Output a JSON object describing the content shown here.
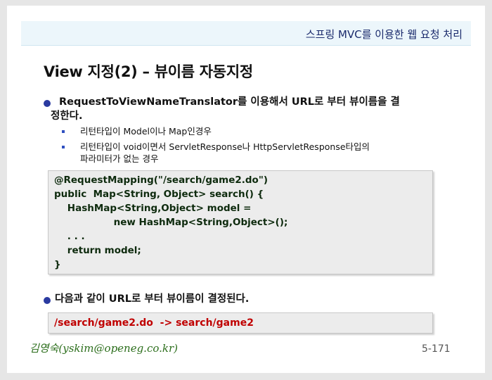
{
  "header": {
    "title": "스프링 MVC를 이용한 웹 요청 처리"
  },
  "slide": {
    "title": "View 지정(2) – 뷰이름 자동지정"
  },
  "bullets": {
    "first_line1": "RequestToViewNameTranslator를 이용해서 URL로 부터 뷰이름을 결",
    "first_line2": "정한다.",
    "sub1": "리턴타입이 Model이나 Map인경우",
    "sub2_line1": "리턴타입이 void이면서 ServletResponse나 HttpServletResponse타입의",
    "sub2_line2": "파라미터가 없는 경우",
    "second": "다음과 같이 URL로 부터 뷰이름이 결정된다."
  },
  "code": {
    "lines": [
      "@RequestMapping(\"/search/game2.do\")",
      "public  Map<String, Object> search() {",
      "    HashMap<String,Object> model =",
      "                  new HashMap<String,Object>();",
      "    . . .",
      "    return model;",
      "}"
    ]
  },
  "result": {
    "text": "/search/game2.do  -> search/game2"
  },
  "footer": {
    "author": "김영숙(yskim@openeg.co.kr)",
    "page_number": "5-171"
  },
  "colors": {
    "header_bg": "#ecf6fb",
    "bullet": "#2a3aa0",
    "code_text": "#0d2a0d",
    "result_text": "#c00000",
    "author_text": "#2c6e1c"
  }
}
